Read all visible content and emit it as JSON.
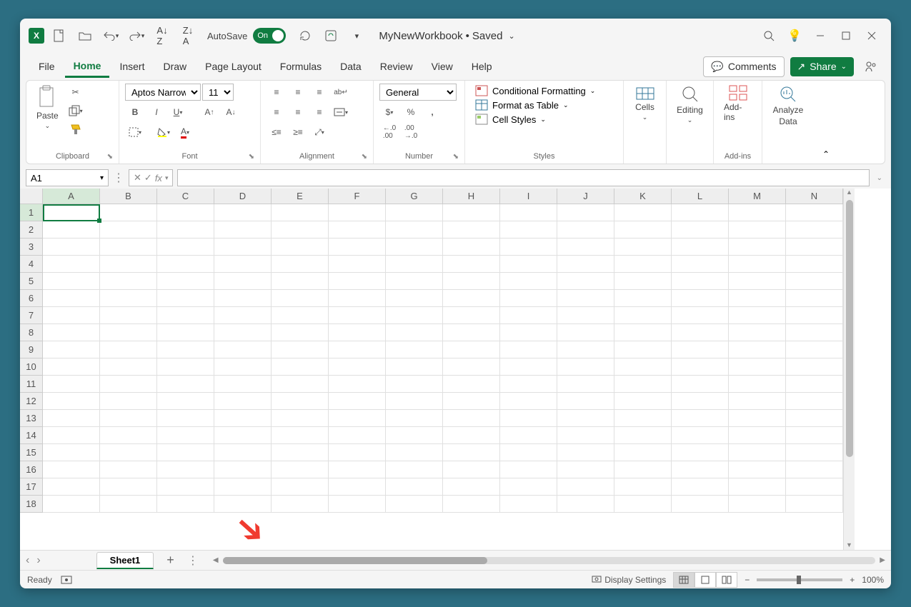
{
  "titlebar": {
    "app_abbrev": "X",
    "autosave_label": "AutoSave",
    "toggle_state": "On",
    "workbook_name": "MyNewWorkbook",
    "save_status": "Saved"
  },
  "ribbon": {
    "tabs": [
      "File",
      "Home",
      "Insert",
      "Draw",
      "Page Layout",
      "Formulas",
      "Data",
      "Review",
      "View",
      "Help"
    ],
    "active_tab": "Home",
    "comments_label": "Comments",
    "share_label": "Share"
  },
  "groups": {
    "clipboard": {
      "label": "Clipboard",
      "paste": "Paste"
    },
    "font": {
      "label": "Font",
      "name": "Aptos Narrow",
      "size": "11"
    },
    "alignment": {
      "label": "Alignment"
    },
    "number": {
      "label": "Number",
      "format": "General"
    },
    "styles": {
      "label": "Styles",
      "conditional": "Conditional Formatting",
      "table": "Format as Table",
      "cell": "Cell Styles"
    },
    "cells": {
      "label": "Cells"
    },
    "editing": {
      "label": "Editing"
    },
    "addins": {
      "label": "Add-ins",
      "btn": "Add-ins"
    },
    "analyze": {
      "label1": "Analyze",
      "label2": "Data"
    }
  },
  "formula_bar": {
    "name_box": "A1",
    "fx": "fx"
  },
  "grid": {
    "columns": [
      "A",
      "B",
      "C",
      "D",
      "E",
      "F",
      "G",
      "H",
      "I",
      "J",
      "K",
      "L",
      "M",
      "N"
    ],
    "rows": [
      1,
      2,
      3,
      4,
      5,
      6,
      7,
      8,
      9,
      10,
      11,
      12,
      13,
      14,
      15,
      16,
      17,
      18
    ],
    "active_cell": "A1"
  },
  "tabs": {
    "sheet": "Sheet1"
  },
  "status": {
    "ready": "Ready",
    "display_settings": "Display Settings",
    "zoom": "100%"
  }
}
